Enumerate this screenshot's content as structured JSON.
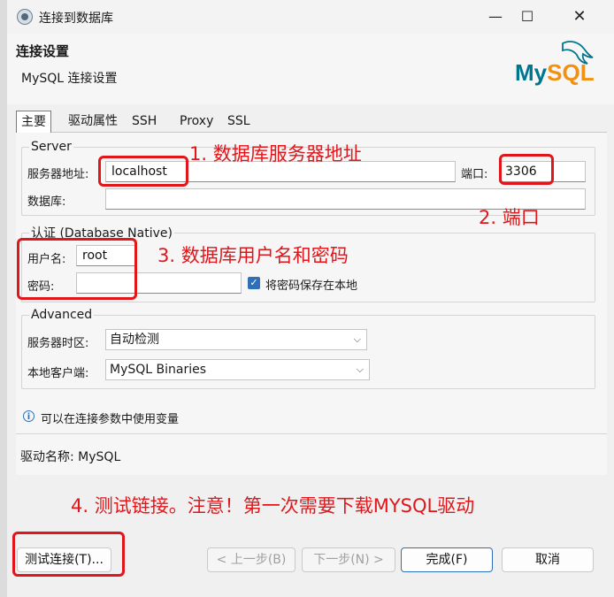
{
  "window": {
    "title": "连接到数据库",
    "controls": {
      "minimize": "—",
      "maximize": "☐",
      "close": "✕"
    }
  },
  "header": {
    "title": "连接设置",
    "subtitle": "MySQL 连接设置",
    "logo_text": "MySQL",
    "logo_colors": {
      "my": "#00758f",
      "sql": "#f29111"
    }
  },
  "tabs": [
    {
      "label": "主要",
      "active": true
    },
    {
      "label": "驱动属性",
      "active": false
    },
    {
      "label": "SSH",
      "active": false
    },
    {
      "label": "Proxy",
      "active": false
    },
    {
      "label": "SSL",
      "active": false
    }
  ],
  "server": {
    "group_title": "Server",
    "host_label": "服务器地址:",
    "host_value": "localhost",
    "port_label": "端口:",
    "port_value": "3306",
    "database_label": "数据库:",
    "database_value": ""
  },
  "auth": {
    "group_title": "认证 (Database Native)",
    "user_label": "用户名:",
    "user_value": "root",
    "password_label": "密码:",
    "password_value": "",
    "save_password_label": "将密码保存在本地",
    "save_password_checked": true
  },
  "advanced": {
    "group_title": "Advanced",
    "timezone_label": "服务器时区:",
    "timezone_value": "自动检测",
    "client_label": "本地客户端:",
    "client_value": "MySQL Binaries"
  },
  "info": {
    "text": "可以在连接参数中使用变量"
  },
  "driver": {
    "label": "驱动名称:",
    "value": "MySQL"
  },
  "annotations": {
    "note1": "1. 数据库服务器地址",
    "note2": "2. 端口",
    "note3": "3. 数据库用户名和密码",
    "note4": "4. 测试链接。注意！第一次需要下载MYSQL驱动",
    "color": "#e0161b"
  },
  "buttons": {
    "test_connection": "测试连接(T)...",
    "prev": "< 上一步(B)",
    "next": "下一步(N) >",
    "finish": "完成(F)",
    "cancel": "取消"
  }
}
